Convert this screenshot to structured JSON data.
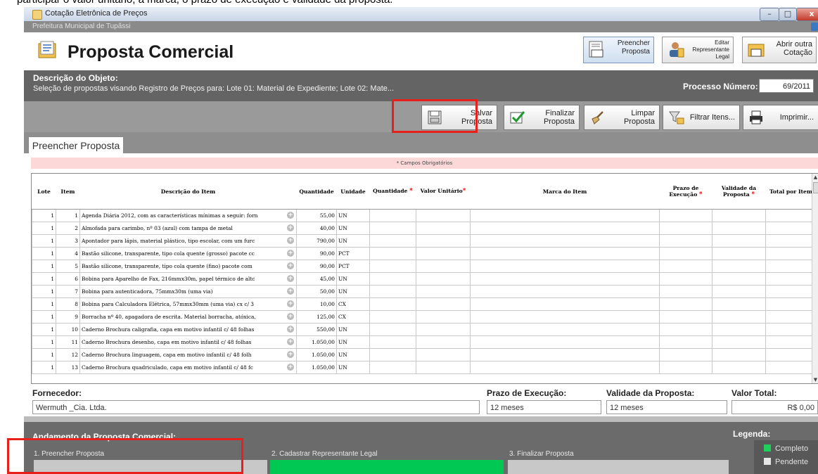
{
  "doc_fragment": "participar o valor unitário, a marca, o prazo de execução e validade da proposta.",
  "window": {
    "title": "Cotação Eletrônica de Preços",
    "subtitle": "Prefeitura Municipal de Tupãssi",
    "minimize": "–",
    "maximize": "□",
    "close": "x"
  },
  "header": {
    "title": "Proposta Comercial",
    "buttons": {
      "preencher": "Preencher\nProposta",
      "editar": "Editar\nRepresentante\nLegal",
      "abrir": "Abrir outra\nCotação"
    }
  },
  "description": {
    "label": "Descrição do Objeto:",
    "text": "Seleção de propostas visando Registro de Preços para: Lote 01: Material de Expediente; Lote 02: Mate...",
    "process_label": "Processo Número:",
    "process_value": "69/2011"
  },
  "toolbar": {
    "salvar": "Salvar\nProposta",
    "finalizar": "Finalizar\nProposta",
    "limpar": "Limpar\nProposta",
    "filtrar": "Filtrar Itens...",
    "imprimir": "Imprimir..."
  },
  "tab": "Preencher Proposta",
  "required_note": "* Campos Obrigatórios",
  "grid": {
    "columns": {
      "lote": "Lote",
      "item": "Item",
      "descricao": "Descrição do Item",
      "quantidade": "Quantidade",
      "unidade": "Unidade",
      "quantidade_req": "Quantidade",
      "valor_unitario": "Valor Unitário",
      "marca": "Marca do Item",
      "prazo": "Prazo de Execução",
      "validade": "Validade da Proposta",
      "total": "Total por Item"
    },
    "rows": [
      {
        "lote": "1",
        "item": "1",
        "descricao": "Agenda Diária 2012, com as características mínimas a seguir: forn",
        "quantidade": "55,00",
        "unidade": "UN"
      },
      {
        "lote": "1",
        "item": "2",
        "descricao": "Almofada para carimbo, nº 03 (azul) com tampa de metal",
        "quantidade": "40,00",
        "unidade": "UN"
      },
      {
        "lote": "1",
        "item": "3",
        "descricao": "Apontador para lápis, material plástico, tipo escolar, com um furc",
        "quantidade": "790,00",
        "unidade": "UN"
      },
      {
        "lote": "1",
        "item": "4",
        "descricao": "Bastão silicone, transparente, tipo cola quente (grosso) pacote cc",
        "quantidade": "90,00",
        "unidade": "PCT"
      },
      {
        "lote": "1",
        "item": "5",
        "descricao": "Bastão silicone, transparente, tipo cola quente (fino) pacote com",
        "quantidade": "90,00",
        "unidade": "PCT"
      },
      {
        "lote": "1",
        "item": "6",
        "descricao": "Bobina para Aparelho de Fax, 216mmx30m, papel térmico de altc",
        "quantidade": "45,00",
        "unidade": "UN"
      },
      {
        "lote": "1",
        "item": "7",
        "descricao": "Bobina para autenticadora, 75mmx30m (uma via)",
        "quantidade": "50,00",
        "unidade": "UN"
      },
      {
        "lote": "1",
        "item": "8",
        "descricao": "Bobina para Calculadora Elétrica, 57mmx30mm (uma via) cx c/ 3",
        "quantidade": "10,00",
        "unidade": "CX"
      },
      {
        "lote": "1",
        "item": "9",
        "descricao": "Borracha nº 40, apagadora de escrita. Material borracha, atóxica,",
        "quantidade": "125,00",
        "unidade": "CX"
      },
      {
        "lote": "1",
        "item": "10",
        "descricao": "Caderno Brochura caligrafia, capa em motivo infantil c/ 48 folhas",
        "quantidade": "550,00",
        "unidade": "UN"
      },
      {
        "lote": "1",
        "item": "11",
        "descricao": "Caderno Brochura desenho, capa em motivo infantil c/ 48 folhas",
        "quantidade": "1.050,00",
        "unidade": "UN"
      },
      {
        "lote": "1",
        "item": "12",
        "descricao": "Caderno Brochura linguagem, capa em motivo infantil c/ 48 folh",
        "quantidade": "1.050,00",
        "unidade": "UN"
      },
      {
        "lote": "1",
        "item": "13",
        "descricao": "Caderno Brochura quadriculado, capa em motivo infantil c/ 48 fc",
        "quantidade": "1.050,00",
        "unidade": "UN"
      }
    ]
  },
  "footer": {
    "fornecedor_label": "Fornecedor:",
    "fornecedor_value": "Wermuth _Cia. Ltda.",
    "prazo_label": "Prazo de Execução:",
    "prazo_value": "12 meses",
    "validade_label": "Validade da Proposta:",
    "validade_value": "12 meses",
    "total_label": "Valor Total:",
    "total_value": "R$ 0,00"
  },
  "progress": {
    "title": "Andamento da Proposta Comercial:",
    "steps": [
      {
        "label": "1. Preencher Proposta",
        "status": "pendente"
      },
      {
        "label": "2. Cadastrar Representante Legal",
        "status": "completo"
      },
      {
        "label": "3. Finalizar Proposta",
        "status": "pendente"
      }
    ],
    "legend_title": "Legenda:",
    "legend": [
      {
        "label": "Completo",
        "color": "#1fd05a"
      },
      {
        "label": "Pendente",
        "color": "#e6e6e6"
      }
    ]
  },
  "colors": {
    "complete": "#00c853",
    "pending": "#c8c8c8",
    "highlight": "#e8201c"
  }
}
